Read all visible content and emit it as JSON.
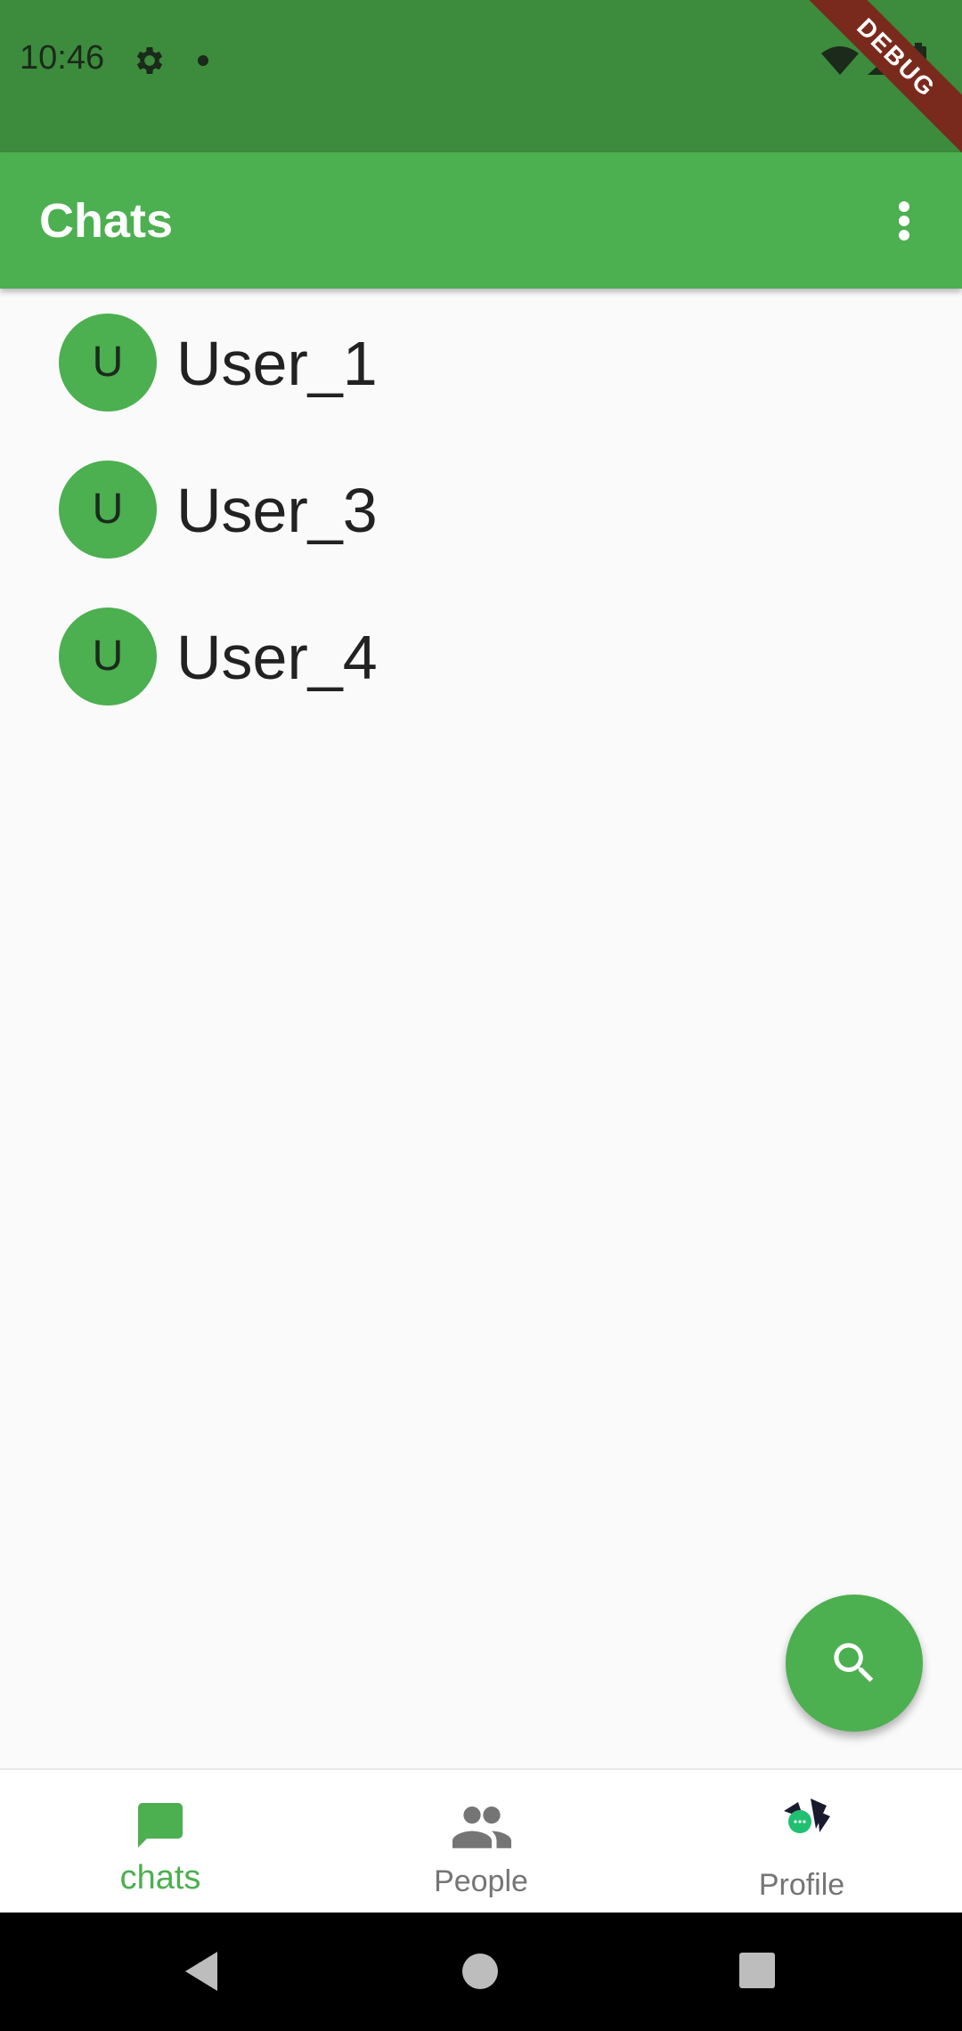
{
  "status_bar": {
    "time": "10:46",
    "debug_label": "DEBUG"
  },
  "app_bar": {
    "title": "Chats"
  },
  "chats": [
    {
      "initial": "U",
      "name": "User_1"
    },
    {
      "initial": "U",
      "name": "User_3"
    },
    {
      "initial": "U",
      "name": "User_4"
    }
  ],
  "bottom_nav": {
    "items": [
      {
        "label": "chats",
        "icon": "chat-bubble-icon",
        "active": true
      },
      {
        "label": "People",
        "icon": "people-icon",
        "active": false
      },
      {
        "label": "Profile",
        "icon": "profile-avatar",
        "active": false
      }
    ]
  },
  "colors": {
    "primary": "#4caf50",
    "status_bar": "#3d8b3d",
    "inactive_nav": "#757575",
    "debug_ribbon": "#7a2a1c"
  }
}
